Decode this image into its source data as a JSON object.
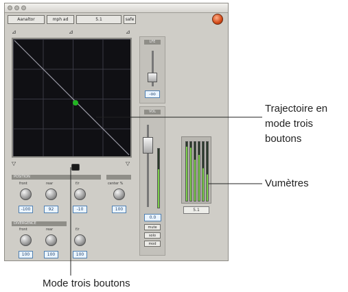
{
  "window": {
    "header_buttons": [
      "Aanaltor",
      "mph ad",
      "5.1",
      "safe"
    ]
  },
  "grid": {
    "marker_color": "#22b522",
    "diag_color": "#9a9aa6"
  },
  "sections": {
    "position": {
      "label": "POSITION",
      "knob_labels": [
        "front",
        "rear",
        "f/r",
        "center %"
      ],
      "values": [
        "-100",
        "92",
        "-10",
        "100"
      ]
    },
    "divergence": {
      "label": "DIVERGENCE",
      "knob_labels": [
        "front",
        "rear",
        "f/r"
      ],
      "values": [
        "100",
        "100",
        "100"
      ]
    }
  },
  "lfe": {
    "label": "LFE",
    "value": "-oo"
  },
  "vol": {
    "label": "VOL",
    "value": "0.0",
    "buttons": [
      "mute",
      "solo",
      "mod"
    ]
  },
  "meters": {
    "output_value": "5.1"
  },
  "callouts": {
    "trajectory": [
      "Trajectoire en",
      "mode trois",
      "boutons"
    ],
    "meters": "Vumètres",
    "mode": "Mode trois boutons"
  },
  "colors": {
    "value_box_border": "#4f7fb0",
    "meter_green": "#7cd04a",
    "power": "#d34a18"
  }
}
